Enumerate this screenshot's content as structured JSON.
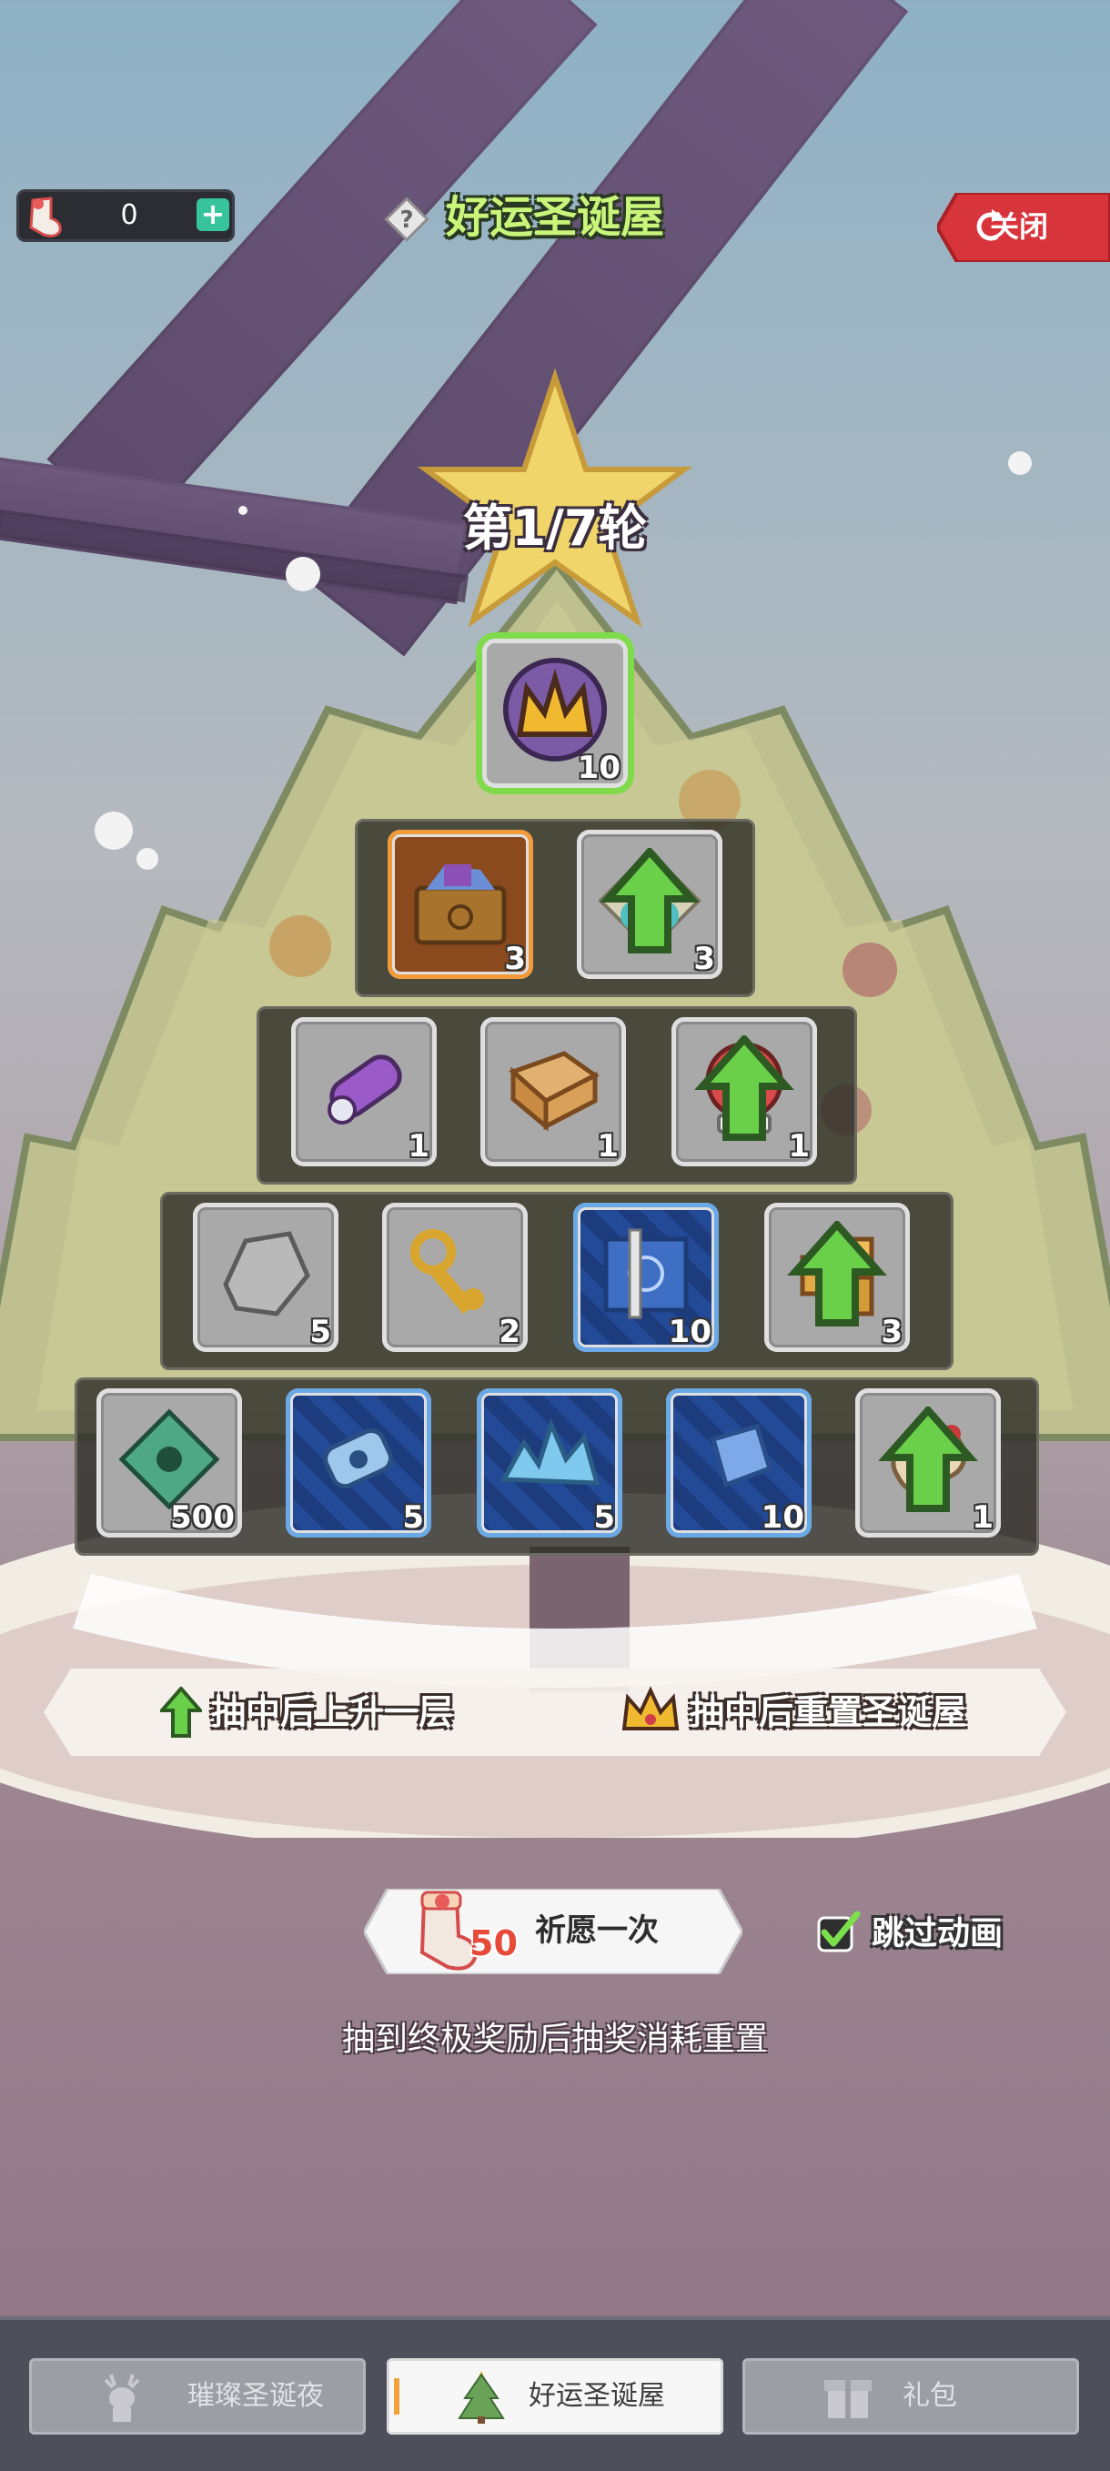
{
  "header": {
    "currency_value": "0",
    "title": "好运圣诞屋",
    "close_label": "关闭"
  },
  "round_label": "第1/7轮",
  "rows": [
    [
      {
        "qty": "10",
        "frame": "green",
        "icon": "ice-crystal-icon",
        "badge": "crown"
      }
    ],
    [
      {
        "qty": "3",
        "frame": "orange",
        "icon": "treasure-chest-icon",
        "badge": ""
      },
      {
        "qty": "3",
        "frame": "gray",
        "icon": "clover-rune-icon",
        "badge": "up"
      }
    ],
    [
      {
        "qty": "1",
        "frame": "gray",
        "icon": "purple-scroll-icon",
        "badge": ""
      },
      {
        "qty": "1",
        "frame": "gray",
        "icon": "old-book-icon",
        "badge": ""
      },
      {
        "qty": "1",
        "frame": "gray",
        "icon": "crystal-ball-icon",
        "badge": "up"
      }
    ],
    [
      {
        "qty": "5",
        "frame": "gray",
        "icon": "stone-icon",
        "badge": ""
      },
      {
        "qty": "2",
        "frame": "gray",
        "icon": "golden-key-icon",
        "badge": ""
      },
      {
        "qty": "10",
        "frame": "blue",
        "icon": "blueprint-icon",
        "badge": ""
      },
      {
        "qty": "3",
        "frame": "gray",
        "icon": "gold-blocks-icon",
        "badge": "up"
      }
    ],
    [
      {
        "qty": "500",
        "frame": "gray",
        "icon": "green-gem-icon",
        "badge": ""
      },
      {
        "qty": "5",
        "frame": "blue",
        "icon": "blue-gear-icon",
        "badge": ""
      },
      {
        "qty": "5",
        "frame": "blue",
        "icon": "ice-shard-icon",
        "badge": ""
      },
      {
        "qty": "10",
        "frame": "blue",
        "icon": "blue-cube-icon",
        "badge": ""
      },
      {
        "qty": "1",
        "frame": "gray",
        "icon": "map-scroll-icon",
        "badge": "up"
      }
    ]
  ],
  "legend": {
    "up_text": "抽中后上升一层",
    "reset_text": "抽中后重置圣诞屋"
  },
  "wish": {
    "cost": "50",
    "label": "祈愿一次"
  },
  "skip_label": "跳过动画",
  "note": "抽到终极奖励后抽奖消耗重置",
  "tabs": [
    {
      "label": "璀璨圣诞夜",
      "active": false,
      "icon": "reindeer-icon"
    },
    {
      "label": "好运圣诞屋",
      "active": true,
      "icon": "christmas-tree-icon"
    },
    {
      "label": "礼包",
      "active": false,
      "icon": "gift-icon"
    }
  ],
  "colors": {
    "accent_green": "#7fdb4b",
    "title_green": "#c8f57a",
    "close_red": "#d7353b",
    "cost_red": "#e84a3a"
  }
}
